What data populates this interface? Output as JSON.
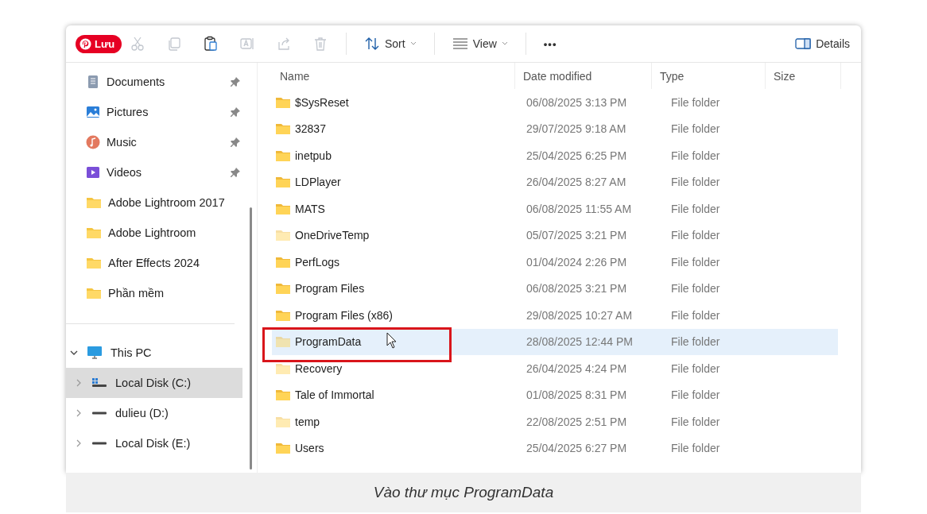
{
  "pin_button": {
    "label": "Lưu"
  },
  "toolbar": {
    "tools": [
      {
        "kind": "cut",
        "disabled": true
      },
      {
        "kind": "copy",
        "disabled": true
      },
      {
        "kind": "paste",
        "disabled": false
      },
      {
        "kind": "rename",
        "disabled": true
      },
      {
        "kind": "share",
        "disabled": true
      },
      {
        "kind": "delete",
        "disabled": true
      }
    ],
    "sort": {
      "label": "Sort"
    },
    "view": {
      "label": "View"
    },
    "more": {
      "label": "•••"
    },
    "details": {
      "label": "Details"
    }
  },
  "sidebar": {
    "quick_access": [
      {
        "kind": "documents",
        "label": "Documents",
        "pinned": true
      },
      {
        "kind": "pictures",
        "label": "Pictures",
        "pinned": true
      },
      {
        "kind": "music",
        "label": "Music",
        "pinned": true
      },
      {
        "kind": "videos",
        "label": "Videos",
        "pinned": true
      },
      {
        "kind": "folder",
        "label": "Adobe Lightroom 2017",
        "pinned": false
      },
      {
        "kind": "folder",
        "label": "Adobe Lightroom",
        "pinned": false
      },
      {
        "kind": "folder",
        "label": "After Effects 2024",
        "pinned": false
      },
      {
        "kind": "folder",
        "label": "Phần mềm",
        "pinned": false
      }
    ],
    "this_pc": {
      "label": "This PC",
      "expanded": true,
      "children": [
        {
          "kind": "system-drive",
          "label": "Local Disk (C:)",
          "selected": true,
          "expanded": false
        },
        {
          "kind": "drive",
          "label": "dulieu (D:)",
          "selected": false,
          "expanded": false
        },
        {
          "kind": "drive",
          "label": "Local Disk (E:)",
          "selected": false,
          "expanded": false
        }
      ]
    }
  },
  "file_list": {
    "columns": [
      "Name",
      "Date modified",
      "Type",
      "Size"
    ],
    "rows": [
      {
        "name": "$SysReset",
        "date": "06/08/2025 3:13 PM",
        "type": "File folder",
        "hidden": false,
        "selected": false,
        "annotated": false
      },
      {
        "name": "32837",
        "date": "29/07/2025 9:18 AM",
        "type": "File folder",
        "hidden": false,
        "selected": false,
        "annotated": false
      },
      {
        "name": "inetpub",
        "date": "25/04/2025 6:25 PM",
        "type": "File folder",
        "hidden": false,
        "selected": false,
        "annotated": false
      },
      {
        "name": "LDPlayer",
        "date": "26/04/2025 8:27 AM",
        "type": "File folder",
        "hidden": false,
        "selected": false,
        "annotated": false
      },
      {
        "name": "MATS",
        "date": "06/08/2025 11:55 AM",
        "type": "File folder",
        "hidden": false,
        "selected": false,
        "annotated": false
      },
      {
        "name": "OneDriveTemp",
        "date": "05/07/2025 3:21 PM",
        "type": "File folder",
        "hidden": true,
        "selected": false,
        "annotated": false
      },
      {
        "name": "PerfLogs",
        "date": "01/04/2024 2:26 PM",
        "type": "File folder",
        "hidden": false,
        "selected": false,
        "annotated": false
      },
      {
        "name": "Program Files",
        "date": "06/08/2025 3:21 PM",
        "type": "File folder",
        "hidden": false,
        "selected": false,
        "annotated": false
      },
      {
        "name": "Program Files (x86)",
        "date": "29/08/2025 10:27 AM",
        "type": "File folder",
        "hidden": false,
        "selected": false,
        "annotated": false
      },
      {
        "name": "ProgramData",
        "date": "28/08/2025 12:44 PM",
        "type": "File folder",
        "hidden": true,
        "selected": true,
        "annotated": true
      },
      {
        "name": "Recovery",
        "date": "26/04/2025 4:24 PM",
        "type": "File folder",
        "hidden": true,
        "selected": false,
        "annotated": false
      },
      {
        "name": "Tale of Immortal",
        "date": "01/08/2025 8:31 PM",
        "type": "File folder",
        "hidden": false,
        "selected": false,
        "annotated": false
      },
      {
        "name": "temp",
        "date": "22/08/2025 2:51 PM",
        "type": "File folder",
        "hidden": true,
        "selected": false,
        "annotated": false
      },
      {
        "name": "Users",
        "date": "25/04/2025 6:27 PM",
        "type": "File folder",
        "hidden": false,
        "selected": false,
        "annotated": false
      }
    ]
  },
  "caption": "Vào thư mục ProgramData"
}
